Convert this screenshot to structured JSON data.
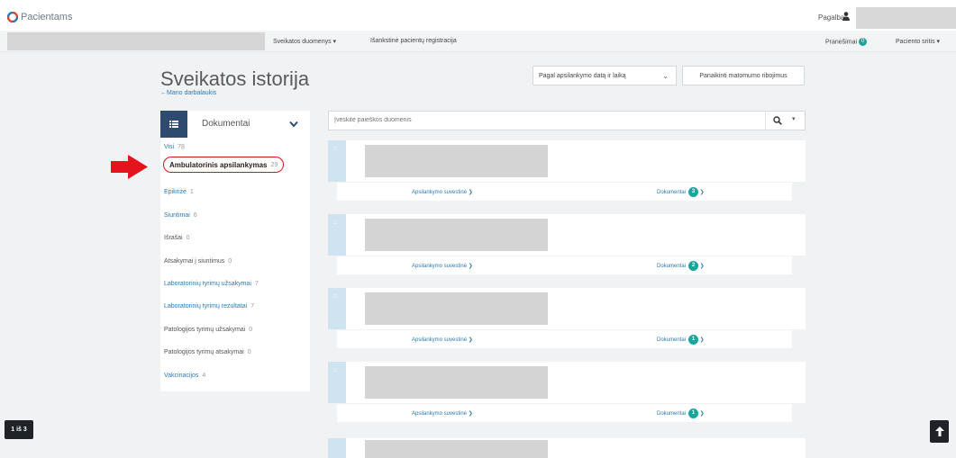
{
  "header": {
    "brand_name": "Pacientams",
    "help_label": "Pagalba"
  },
  "nav": {
    "health_data": "Sveikatos duomenys ▾",
    "register": "Išankstinė pacientų registracija",
    "notifications": "Pranešimai",
    "notifications_count": "0",
    "patient_area": "Paciento sritis ▾"
  },
  "page": {
    "title": "Sveikatos istorija",
    "back_link": "←Mano darbalaukis",
    "sort_label": "Pagal apsilankymo datą ir laiką",
    "clear_button": "Panaikinti matomumo ribojimus"
  },
  "sidebar": {
    "header_label": "Dokumentai",
    "items": [
      {
        "label": "Visi",
        "count": "78"
      },
      {
        "label": "Ambulatorinis apsilankymas",
        "count": "29"
      },
      {
        "label": "Epikrizė",
        "count": "1"
      },
      {
        "label": "Siuntimai",
        "count": "6"
      },
      {
        "label": "Išrašai",
        "count": "0"
      },
      {
        "label": "Atsakymai į siuntimus",
        "count": "0"
      },
      {
        "label": "Laboratorinių tyrimų užsakymai",
        "count": "7"
      },
      {
        "label": "Laboratorinių tyrimų rezultatai",
        "count": "7"
      },
      {
        "label": "Patologijos tyrimų užsakymai",
        "count": "0"
      },
      {
        "label": "Patologijos tyrimų atsakymai",
        "count": "0"
      },
      {
        "label": "Vakcinacijos",
        "count": "4"
      }
    ]
  },
  "search": {
    "placeholder": "Įveskite paieškos duomenis"
  },
  "cards": [
    {
      "summary_label": "Apsilankymo suvestinė",
      "docs_label": "Dokumentai",
      "docs_count": "3"
    },
    {
      "summary_label": "Apsilankymo suvestinė",
      "docs_label": "Dokumentai",
      "docs_count": "2"
    },
    {
      "summary_label": "Apsilankymo suvestinė",
      "docs_label": "Dokumentai",
      "docs_count": "1"
    },
    {
      "summary_label": "Apsilankymo suvestinė",
      "docs_label": "Dokumentai",
      "docs_count": "1"
    }
  ],
  "pager": {
    "label": "1 iš 3"
  },
  "colors": {
    "accent_teal": "#1aa59a",
    "sidebar_header": "#2e4a6f",
    "highlight_red": "#d0151f",
    "link_blue": "#2f79b0"
  }
}
